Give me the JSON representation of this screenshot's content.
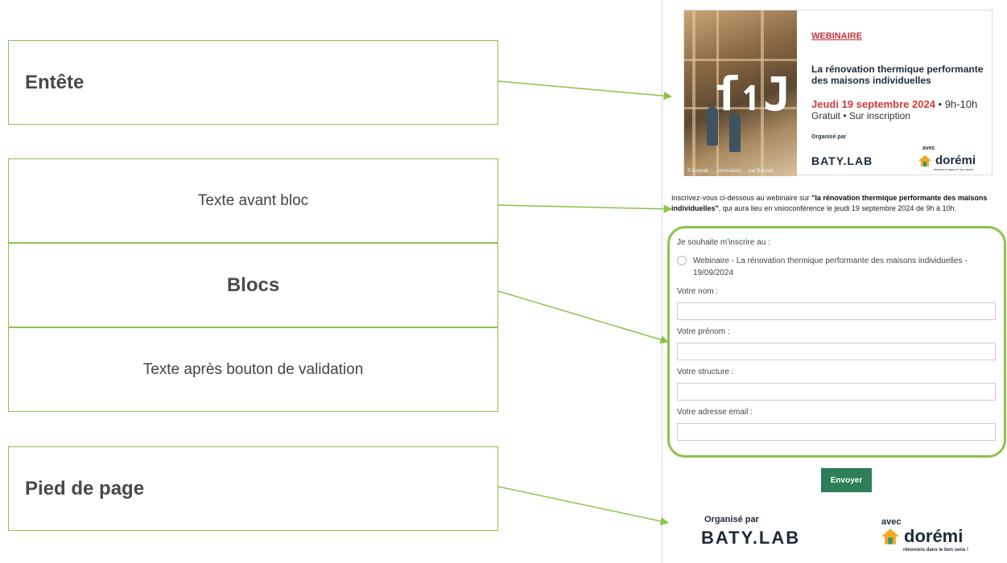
{
  "annotations": {
    "entete": "Entête",
    "texte_avant_bloc": "Texte avant bloc",
    "blocs": "Blocs",
    "texte_apres": "Texte après bouton de validation",
    "pied_de_page": "Pied de page"
  },
  "colors": {
    "accent_green": "#8bc34a",
    "button_green": "#2e7d5b",
    "banner_red": "#d33a3a"
  },
  "banner": {
    "label": "WEBINAIRE",
    "title": "La rénovation thermique performante des maisons individuelles",
    "date": "Jeudi 19 septembre 2024",
    "time": " • 9h-10h",
    "pricing": "Gratuit • Sur inscription",
    "organise_par": "Organisé par",
    "baty": "BATY.LAB",
    "avec": "avec",
    "doremi": "dorémi",
    "doremi_tagline": "rénovons dans le bon sens !",
    "photo_caption": "© Batylab - ... rénovation, ... par Batylab"
  },
  "intro": {
    "before": "Inscrivez-vous ci-dessous au webinaire sur ",
    "bold": "\"la rénovation thermique performante des maisons individuelles\"",
    "after": ", qui aura lieu en visioconférence le jeudi 19 septembre 2024 de 9h à 10h."
  },
  "form": {
    "question": "Je souhaite m'inscrire au :",
    "option": "Webinaire - La rénovation thermique performante des maisons individuelles - 19/09/2024",
    "nom_label": "Votre nom :",
    "prenom_label": "Votre prénom :",
    "structure_label": "Votre structure :",
    "email_label": "Votre adresse email :",
    "submit": "Envoyer"
  },
  "footer": {
    "organise_par": "Organisé par",
    "baty": "BATY.LAB",
    "avec": "avec",
    "doremi": "dorémi",
    "tagline": "rénovons dans le bon sens !"
  }
}
